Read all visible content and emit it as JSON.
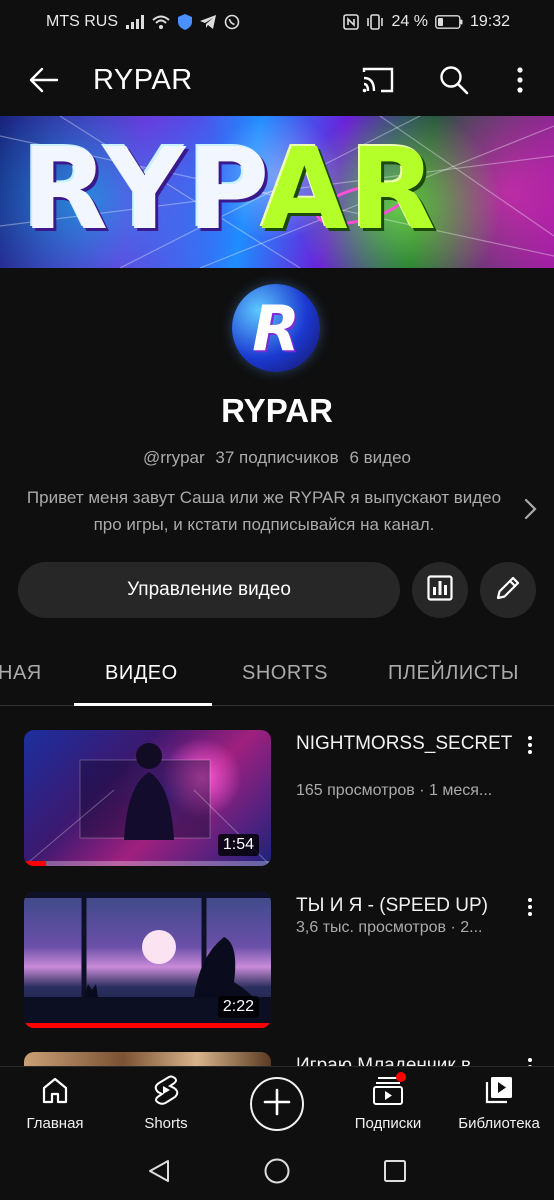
{
  "status_bar": {
    "carrier": "MTS RUS",
    "battery": "24 %",
    "time": "19:32"
  },
  "app_bar": {
    "title": "RYPAR",
    "icons": [
      "arrow-back-icon",
      "cast-icon",
      "search-icon",
      "more-vert-icon"
    ]
  },
  "channel": {
    "banner_text_white": "RYP",
    "banner_text_green": "AR",
    "avatar_letter": "R",
    "name": "RYPAR",
    "handle": "@rrypar",
    "subscribers": "37 подписчиков",
    "videos_count": "6 видео",
    "description": "Привет меня завут Саша или же RYPAR я выпускают видео про игры, и кстати подписывайся на канал."
  },
  "actions": {
    "manage_label": "Управление видео",
    "icons": [
      "analytics-icon",
      "edit-pencil-icon"
    ]
  },
  "tabs": [
    {
      "label": "НАЯ"
    },
    {
      "label": "ВИДЕО"
    },
    {
      "label": "SHORTS"
    },
    {
      "label": "ПЛЕЙЛИСТЫ"
    }
  ],
  "active_tab": "ВИДЕО",
  "videos": [
    {
      "title": "NIGHTMORSS_SECRET",
      "meta": "165 просмотров · 1 меся...",
      "duration": "1:54",
      "watched_fraction": 0.09
    },
    {
      "title": "ТЫ И Я - (SPEED UP)",
      "meta": "3,6 тыс. просмотров · 2...",
      "duration": "2:22",
      "watched_fraction": 1.0
    },
    {
      "title": "Играю Младенчик в ...",
      "meta": "",
      "duration": "",
      "watched_fraction": 0
    }
  ],
  "bottom_nav": [
    {
      "label": "Главная",
      "icon": "home-icon"
    },
    {
      "label": "Shorts",
      "icon": "shorts-icon"
    },
    {
      "label": "",
      "icon": "create-plus-icon"
    },
    {
      "label": "Подписки",
      "icon": "subscriptions-icon"
    },
    {
      "label": "Библиотека",
      "icon": "library-icon"
    }
  ],
  "colors": {
    "background": "#0f0f0f",
    "surface": "#272727",
    "secondary_text": "#aaaaaa",
    "accent_red": "#ff0000"
  }
}
